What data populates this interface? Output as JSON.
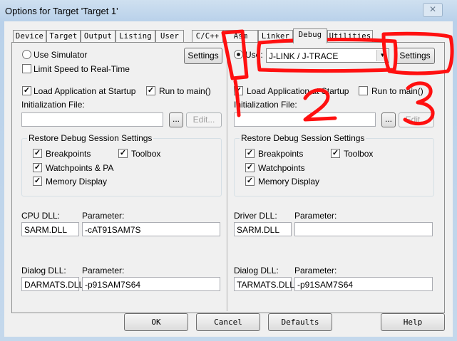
{
  "window": {
    "title": "Options for Target 'Target 1'",
    "close_glyph": "✕"
  },
  "tabs": [
    "Device",
    "Target",
    "Output",
    "Listing",
    "User",
    "C/C++",
    "Asm",
    "Linker",
    "Debug",
    "Utilities"
  ],
  "left": {
    "use_simulator": "Use Simulator",
    "limit_speed": "Limit Speed to Real-Time",
    "settings_button": "Settings",
    "load_app": "Load Application at Startup",
    "run_to_main": "Run to main()",
    "init_file_label": "Initialization File:",
    "init_file_value": "",
    "browse_button": "...",
    "edit_button": "Edit...",
    "restore_group": "Restore Debug Session Settings",
    "breakpoints": "Breakpoints",
    "toolbox": "Toolbox",
    "watchpoints": "Watchpoints & PA",
    "memory_display": "Memory Display",
    "cpu_dll_label": "CPU DLL:",
    "cpu_dll_value": "SARM.DLL",
    "param_label_1": "Parameter:",
    "cpu_param_value": "-cAT91SAM7S",
    "dialog_dll_label": "Dialog DLL:",
    "dialog_dll_value": "DARMATS.DLL",
    "param_label_2": "Parameter:",
    "dialog_param_value": "-p91SAM7S64"
  },
  "right": {
    "use_label": "Use:",
    "driver_select": "J-LINK / J-TRACE",
    "settings_button": "Settings",
    "load_app": "Load Application at Startup",
    "run_to_main": "Run to main()",
    "init_file_label": "Initialization File:",
    "init_file_value": "",
    "browse_button": "...",
    "edit_button": "Edit...",
    "restore_group": "Restore Debug Session Settings",
    "breakpoints": "Breakpoints",
    "toolbox": "Toolbox",
    "watchpoints": "Watchpoints",
    "memory_display": "Memory Display",
    "driver_dll_label": "Driver DLL:",
    "driver_dll_value": "SARM.DLL",
    "param_label_1": "Parameter:",
    "driver_param_value": "",
    "dialog_dll_label": "Dialog DLL:",
    "dialog_dll_value": "TARMATS.DLL",
    "param_label_2": "Parameter:",
    "dialog_param_value": "-p91SAM7S64"
  },
  "buttons": {
    "ok": "OK",
    "cancel": "Cancel",
    "defaults": "Defaults",
    "help": "Help"
  },
  "annotations": {
    "color": "#ff1010",
    "numbers": [
      "1",
      "2",
      "3"
    ]
  },
  "state": {
    "use_simulator_selected": false,
    "use_driver_selected": true,
    "limit_speed_checked": false,
    "left_load_app_checked": true,
    "left_run_to_main_checked": true,
    "right_load_app_checked": true,
    "right_run_to_main_checked": false
  }
}
